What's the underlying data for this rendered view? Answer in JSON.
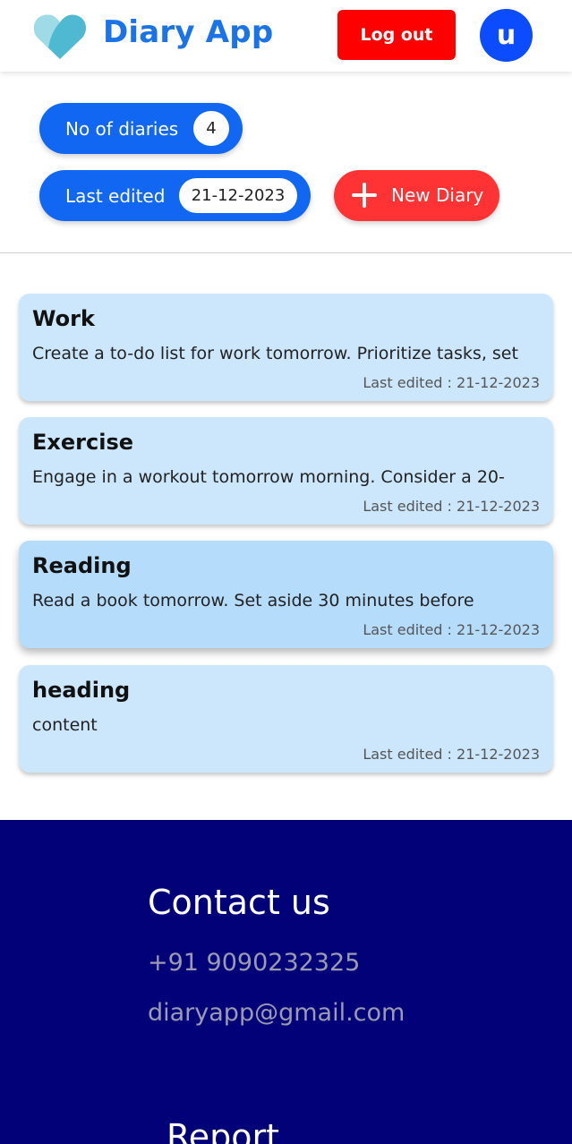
{
  "header": {
    "brand": "Diary App",
    "logout_label": "Log out",
    "avatar_initial": "u"
  },
  "stats": {
    "count_label": "No of diaries",
    "count_value": "4",
    "edited_label": "Last edited",
    "edited_value": "21-12-2023"
  },
  "new_diary_label": "New Diary",
  "diaries": [
    {
      "title": "Work",
      "content": "Create a to-do list for work tomorrow. Prioritize tasks, set",
      "date": "Last edited : 21-12-2023"
    },
    {
      "title": "Exercise",
      "content": "Engage in a workout tomorrow morning. Consider a 20-",
      "date": "Last edited : 21-12-2023"
    },
    {
      "title": "Reading",
      "content": "Read a book tomorrow. Set aside 30 minutes before",
      "date": "Last edited : 21-12-2023"
    },
    {
      "title": "heading",
      "content": "content",
      "date": "Last edited : 21-12-2023"
    }
  ],
  "footer": {
    "contact_heading": "Contact us",
    "phone": "+91 9090232325",
    "email": "diaryapp@gmail.com",
    "report_heading": "Report"
  },
  "colors": {
    "brand": "#1a73e8",
    "logout": "#ff0000",
    "pill": "#1167f2",
    "new_button": "#ff3333",
    "card": "#cce7fc",
    "footer": "#020178"
  },
  "icons": {
    "logo": "heart-logo-icon",
    "new": "plus-icon"
  }
}
